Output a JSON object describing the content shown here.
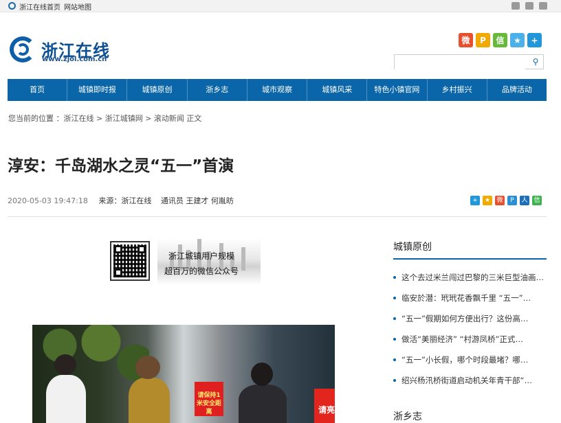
{
  "topbar": {
    "home": "浙江在线首页",
    "sitemap": "网站地图"
  },
  "logo": {
    "name": "浙江在线",
    "url": "www.zjol.com.cn"
  },
  "share_top": [
    {
      "icon": "weibo-icon",
      "color": "#e8502d",
      "glyph": "微"
    },
    {
      "icon": "tencent-weibo-icon",
      "color": "#f2a900",
      "glyph": "P"
    },
    {
      "icon": "wechat-icon",
      "color": "#66b93a",
      "glyph": "信"
    },
    {
      "icon": "qzone-icon",
      "color": "#4cb1e8",
      "glyph": "★"
    },
    {
      "icon": "more-share-icon",
      "color": "#2196d9",
      "glyph": "+"
    }
  ],
  "search": {
    "placeholder": ""
  },
  "nav": [
    "首页",
    "城镇即时报",
    "城镇原创",
    "浙乡志",
    "城市观察",
    "城镇风采",
    "特色小镇官网",
    "乡村振兴",
    "品牌活动"
  ],
  "breadcrumb": "您当前的位置 ：浙江在线 > 浙江城镇网 > 滚动新闻 正文",
  "article": {
    "title": "淳安：千岛湖水之灵“五一”首演",
    "date": "2020-05-03 19:47:18",
    "source": "来源：浙江在线",
    "reporter": "通讯员 王建才 何胤昉"
  },
  "banner": {
    "line1": "浙江城镇用户规模",
    "line2": "超百万的微信公众号"
  },
  "photo": {
    "sign1": "请保持1米安全距离",
    "sign2": "请亮码入场"
  },
  "sidebar": {
    "section1_title": "城镇原创",
    "items": [
      "这个去过米兰闯过巴黎的三米巨型油画…",
      "临安於潜：玳玳花香飘千里 “五一”…",
      "“五一”假期如何方便出行？这份高…",
      "做活“美丽经济” “村游凤桥”正式…",
      "“五一”小长假，哪个时段最堵？哪…",
      "绍兴杨汛桥街道启动机关年青干部“…"
    ],
    "section2_title": "浙乡志"
  },
  "colors": {
    "nav_blue": "#0a66a8",
    "brand_blue": "#0c4f93"
  }
}
